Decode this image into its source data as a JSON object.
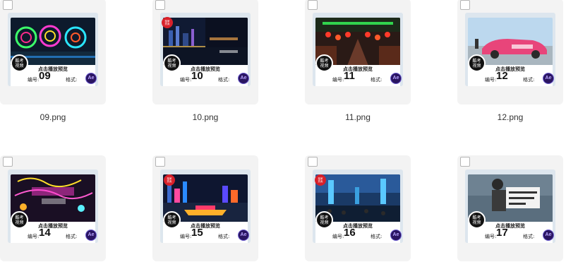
{
  "tiles": [
    {
      "filename": "09.png",
      "number": "09",
      "hot": false
    },
    {
      "filename": "10.png",
      "number": "10",
      "hot": true
    },
    {
      "filename": "11.png",
      "number": "11",
      "hot": false
    },
    {
      "filename": "12.png",
      "number": "12",
      "hot": false
    },
    {
      "filename": "",
      "number": "14",
      "hot": false
    },
    {
      "filename": "",
      "number": "15",
      "hot": true
    },
    {
      "filename": "",
      "number": "16",
      "hot": true
    },
    {
      "filename": "",
      "number": "17",
      "hot": false
    }
  ],
  "card": {
    "preview_text": "点击播放预览",
    "number_label": "编号:",
    "format_label": "格式:",
    "format_icon": "Ae",
    "badge_line1": "酷考",
    "badge_line2": "视频",
    "hot_line1": "独家",
    "hot_line2": "热卖"
  }
}
